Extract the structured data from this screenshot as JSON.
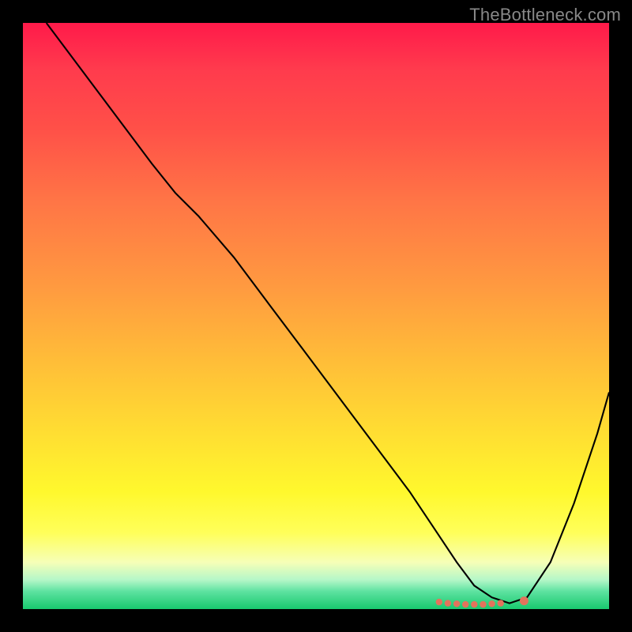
{
  "watermark": "TheBottleneck.com",
  "colors": {
    "background": "#000000",
    "gradient_top": "#ff1a4a",
    "gradient_bottom": "#18c96e",
    "curve": "#000000",
    "marker": "#e3735c"
  },
  "chart_data": {
    "type": "line",
    "title": "",
    "xlabel": "",
    "ylabel": "",
    "xlim": [
      0,
      100
    ],
    "ylim": [
      0,
      100
    ],
    "grid": false,
    "legend": false,
    "series": [
      {
        "name": "bottleneck-curve",
        "x": [
          4,
          10,
          16,
          22,
          26,
          30,
          36,
          42,
          48,
          54,
          60,
          66,
          70,
          74,
          77,
          80,
          83,
          86,
          90,
          94,
          98,
          100
        ],
        "y": [
          100,
          92,
          84,
          76,
          71,
          67,
          60,
          52,
          44,
          36,
          28,
          20,
          14,
          8,
          4,
          2,
          1,
          2,
          8,
          18,
          30,
          37
        ]
      }
    ],
    "markers": {
      "name": "highlighted-points",
      "x": [
        71,
        72.5,
        74,
        75.5,
        77,
        78.5,
        80,
        81.5,
        85.5
      ],
      "y": [
        1.2,
        1.0,
        0.9,
        0.8,
        0.8,
        0.8,
        0.9,
        1.0,
        1.4
      ]
    },
    "axes_visible": false
  }
}
